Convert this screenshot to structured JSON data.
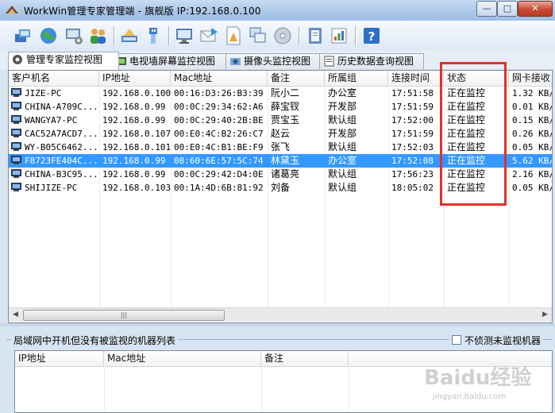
{
  "window": {
    "title": "WorkWin管理专家管理端 - 旗舰版 IP:192.168.0.100"
  },
  "tabs": [
    {
      "label": "管理专家监控视图",
      "active": true
    },
    {
      "label": "电视墙屏幕监控视图",
      "active": false
    },
    {
      "label": "摄像头监控视图",
      "active": false
    },
    {
      "label": "历史数据查询视图",
      "active": false
    }
  ],
  "table": {
    "columns": [
      "客户机名",
      "IP地址",
      "Mac地址",
      "备注",
      "所属组",
      "连接时间",
      "状态",
      "网卡接收"
    ],
    "rows": [
      {
        "name": "JIZE-PC",
        "ip": "192.168.0.100",
        "mac": "00:16:D3:26:B3:39",
        "note": "阮小二",
        "group": "办公室",
        "time": "17:51:58",
        "status": "正在监控",
        "rx": "1.32 KB/",
        "selected": false
      },
      {
        "name": "CHINA-A709C...",
        "ip": "192.168.0.99",
        "mac": "00:0C:29:34:62:A6",
        "note": "薛宝钗",
        "group": "开发部",
        "time": "17:51:59",
        "status": "正在监控",
        "rx": "0.01 KB/",
        "selected": false
      },
      {
        "name": "WANGYA7-PC",
        "ip": "192.168.0.99",
        "mac": "00:0C:29:40:2B:BE",
        "note": "贾宝玉",
        "group": "默认组",
        "time": "17:52:00",
        "status": "正在监控",
        "rx": "0.15 KB/",
        "selected": false
      },
      {
        "name": "CAC52A7ACD7...",
        "ip": "192.168.0.107",
        "mac": "00:E0:4C:B2:26:C7",
        "note": "赵云",
        "group": "开发部",
        "time": "17:51:59",
        "status": "正在监控",
        "rx": "0.26 KB/",
        "selected": false
      },
      {
        "name": "WY-B05C6462...",
        "ip": "192.168.0.101",
        "mac": "00:E0:4C:B1:BE:F9",
        "note": "张飞",
        "group": "默认组",
        "time": "17:52:03",
        "status": "正在监控",
        "rx": "0.05 KB/",
        "selected": false
      },
      {
        "name": "F8723FE404C...",
        "ip": "192.168.0.99",
        "mac": "08:60:6E:57:5C:74",
        "note": "林黛玉",
        "group": "办公室",
        "time": "17:52:08",
        "status": "正在监控",
        "rx": "5.62 KB/",
        "selected": true
      },
      {
        "name": "CHINA-B3C95...",
        "ip": "192.168.0.99",
        "mac": "00:0C:29:42:D4:0E",
        "note": "诸葛亮",
        "group": "默认组",
        "time": "17:56:23",
        "status": "正在监控",
        "rx": "2.16 KB/",
        "selected": false
      },
      {
        "name": "SHIJIZE-PC",
        "ip": "192.168.0.103",
        "mac": "00:1A:4D:6B:81:92",
        "note": "刘备",
        "group": "默认组",
        "time": "18:05:02",
        "status": "正在监控",
        "rx": "0.05 KB/",
        "selected": false
      }
    ]
  },
  "bottom": {
    "group_title": "局域网中开机但没有被监视的机器列表",
    "checkbox_label": "不侦测未监视机器",
    "checkbox_checked": false,
    "columns": [
      "IP地址",
      "Mac地址",
      "备注"
    ]
  },
  "watermark": {
    "main": "Baidu经验",
    "sub": "jingyan.baidu.com"
  },
  "colors": {
    "selection": "#3399ff",
    "highlight_box": "#e03030"
  }
}
